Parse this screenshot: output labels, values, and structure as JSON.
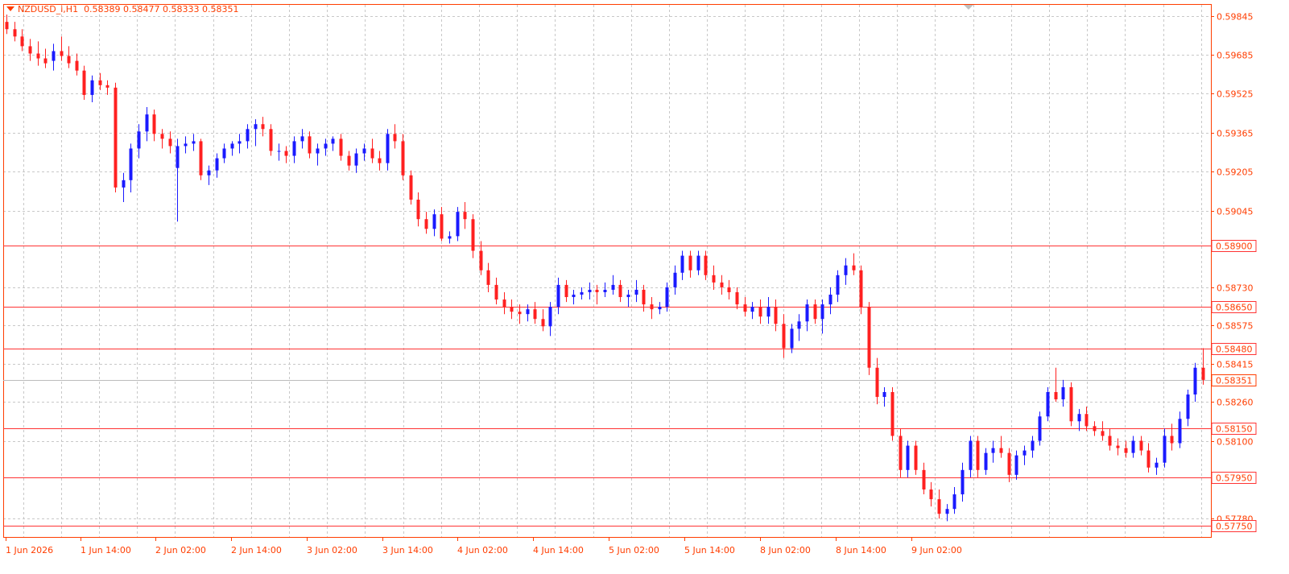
{
  "header": {
    "symbol": "NZDUSD_i,H1",
    "ohlc": "0.58389 0.58477 0.58333 0.58351"
  },
  "colors": {
    "up": "#1a1aff",
    "down": "#ff2020",
    "grid": "#c8c8c8",
    "axis_text": "#ff3d00",
    "hline": "#ff3333",
    "frame": "#ff3d00"
  },
  "chart_data": {
    "type": "candlestick",
    "y_range": [
      0.57705,
      0.5989
    ],
    "y_ticks": [
      "0.59845",
      "0.59685",
      "0.59525",
      "0.59365",
      "0.59205",
      "0.59045",
      "0.58730",
      "0.58575",
      "0.58415",
      "0.58260",
      "0.58100",
      "0.57780"
    ],
    "x_ticks": [
      "1 Jun 2026",
      "1 Jun 14:00",
      "2 Jun 02:00",
      "2 Jun 14:00",
      "3 Jun 02:00",
      "3 Jun 14:00",
      "4 Jun 02:00",
      "4 Jun 14:00",
      "5 Jun 02:00",
      "5 Jun 14:00",
      "8 Jun 02:00",
      "8 Jun 14:00",
      "9 Jun 02:00"
    ],
    "horizontal_levels": [
      "0.58900",
      "0.58650",
      "0.58480",
      "0.58150",
      "0.57950",
      "0.57750"
    ],
    "current_price": "0.58351",
    "candles": [
      [
        0.5982,
        0.5985,
        0.5977,
        0.5979
      ],
      [
        0.5979,
        0.5982,
        0.5974,
        0.5976
      ],
      [
        0.5976,
        0.5979,
        0.597,
        0.5972
      ],
      [
        0.5972,
        0.5975,
        0.5966,
        0.5969
      ],
      [
        0.5969,
        0.5974,
        0.5964,
        0.5967
      ],
      [
        0.5967,
        0.5971,
        0.5963,
        0.5965
      ],
      [
        0.5966,
        0.5973,
        0.5962,
        0.597
      ],
      [
        0.597,
        0.5976,
        0.5966,
        0.5968
      ],
      [
        0.5968,
        0.5972,
        0.5963,
        0.5965
      ],
      [
        0.5966,
        0.5969,
        0.596,
        0.5962
      ],
      [
        0.5962,
        0.5964,
        0.595,
        0.5952
      ],
      [
        0.5952,
        0.596,
        0.5949,
        0.5958
      ],
      [
        0.5958,
        0.5961,
        0.5954,
        0.5956
      ],
      [
        0.5956,
        0.5958,
        0.5952,
        0.5955
      ],
      [
        0.5955,
        0.5957,
        0.5912,
        0.5914
      ],
      [
        0.5914,
        0.592,
        0.5908,
        0.5917
      ],
      [
        0.5917,
        0.5932,
        0.5912,
        0.593
      ],
      [
        0.593,
        0.594,
        0.5926,
        0.5937
      ],
      [
        0.5937,
        0.5947,
        0.5933,
        0.5944
      ],
      [
        0.5944,
        0.5946,
        0.5933,
        0.5936
      ],
      [
        0.5936,
        0.5938,
        0.593,
        0.5934
      ],
      [
        0.5934,
        0.5937,
        0.5928,
        0.5931
      ],
      [
        0.5922,
        0.5934,
        0.59,
        0.5931
      ],
      [
        0.5931,
        0.5935,
        0.5928,
        0.5932
      ],
      [
        0.5932,
        0.5936,
        0.5929,
        0.5933
      ],
      [
        0.5933,
        0.5934,
        0.5917,
        0.5919
      ],
      [
        0.5919,
        0.5923,
        0.5915,
        0.5921
      ],
      [
        0.5921,
        0.5928,
        0.5918,
        0.5926
      ],
      [
        0.5926,
        0.5932,
        0.5924,
        0.593
      ],
      [
        0.593,
        0.5933,
        0.5927,
        0.5932
      ],
      [
        0.5932,
        0.5936,
        0.5928,
        0.5933
      ],
      [
        0.5933,
        0.594,
        0.593,
        0.5938
      ],
      [
        0.5938,
        0.5942,
        0.5931,
        0.594
      ],
      [
        0.594,
        0.5943,
        0.5935,
        0.5938
      ],
      [
        0.5938,
        0.594,
        0.5927,
        0.5929
      ],
      [
        0.5929,
        0.5932,
        0.5925,
        0.5929
      ],
      [
        0.5929,
        0.5931,
        0.5924,
        0.5927
      ],
      [
        0.5927,
        0.5935,
        0.5924,
        0.5933
      ],
      [
        0.5933,
        0.5938,
        0.593,
        0.5935
      ],
      [
        0.5935,
        0.5937,
        0.5926,
        0.5928
      ],
      [
        0.5928,
        0.5932,
        0.5923,
        0.593
      ],
      [
        0.593,
        0.5934,
        0.5927,
        0.5932
      ],
      [
        0.5932,
        0.5935,
        0.5929,
        0.5934
      ],
      [
        0.5934,
        0.5936,
        0.5925,
        0.5927
      ],
      [
        0.5927,
        0.5929,
        0.5921,
        0.5923
      ],
      [
        0.5923,
        0.593,
        0.592,
        0.5928
      ],
      [
        0.5928,
        0.5932,
        0.5925,
        0.593
      ],
      [
        0.593,
        0.5934,
        0.5924,
        0.5926
      ],
      [
        0.5926,
        0.5929,
        0.5921,
        0.5924
      ],
      [
        0.5924,
        0.5938,
        0.5921,
        0.5936
      ],
      [
        0.5936,
        0.594,
        0.593,
        0.5933
      ],
      [
        0.5933,
        0.5936,
        0.5917,
        0.5919
      ],
      [
        0.5919,
        0.5921,
        0.5907,
        0.5909
      ],
      [
        0.5909,
        0.5912,
        0.5898,
        0.5901
      ],
      [
        0.5901,
        0.5904,
        0.5895,
        0.5897
      ],
      [
        0.5897,
        0.5905,
        0.5894,
        0.5903
      ],
      [
        0.5903,
        0.5906,
        0.5892,
        0.5893
      ],
      [
        0.5893,
        0.5896,
        0.5891,
        0.5894
      ],
      [
        0.5894,
        0.5906,
        0.5892,
        0.5904
      ],
      [
        0.5904,
        0.5908,
        0.5897,
        0.5901
      ],
      [
        0.5901,
        0.5903,
        0.5885,
        0.5888
      ],
      [
        0.5888,
        0.5892,
        0.5878,
        0.588
      ],
      [
        0.588,
        0.5883,
        0.5871,
        0.5874
      ],
      [
        0.5874,
        0.5877,
        0.5866,
        0.5868
      ],
      [
        0.5868,
        0.5871,
        0.5862,
        0.5865
      ],
      [
        0.5865,
        0.5868,
        0.586,
        0.5863
      ],
      [
        0.5863,
        0.5866,
        0.5858,
        0.5862
      ],
      [
        0.5862,
        0.5866,
        0.5859,
        0.5864
      ],
      [
        0.5864,
        0.5867,
        0.5858,
        0.586
      ],
      [
        0.586,
        0.5864,
        0.5855,
        0.5857
      ],
      [
        0.5857,
        0.5867,
        0.5853,
        0.5865
      ],
      [
        0.5865,
        0.5877,
        0.5862,
        0.5874
      ],
      [
        0.5874,
        0.5876,
        0.5867,
        0.5869
      ],
      [
        0.5869,
        0.5872,
        0.5866,
        0.587
      ],
      [
        0.587,
        0.5873,
        0.5868,
        0.5871
      ],
      [
        0.5871,
        0.5875,
        0.5868,
        0.5872
      ],
      [
        0.5872,
        0.5874,
        0.5866,
        0.5871
      ],
      [
        0.5871,
        0.5875,
        0.5869,
        0.5872
      ],
      [
        0.5872,
        0.5878,
        0.587,
        0.5874
      ],
      [
        0.5874,
        0.5876,
        0.5867,
        0.5869
      ],
      [
        0.5869,
        0.5872,
        0.5865,
        0.587
      ],
      [
        0.587,
        0.5876,
        0.5867,
        0.5872
      ],
      [
        0.5872,
        0.5874,
        0.5863,
        0.5866
      ],
      [
        0.5866,
        0.5869,
        0.586,
        0.5864
      ],
      [
        0.5864,
        0.5867,
        0.5862,
        0.5865
      ],
      [
        0.5865,
        0.5875,
        0.5863,
        0.5873
      ],
      [
        0.5873,
        0.5882,
        0.587,
        0.5879
      ],
      [
        0.5879,
        0.5888,
        0.5876,
        0.5886
      ],
      [
        0.5886,
        0.5888,
        0.5877,
        0.588
      ],
      [
        0.588,
        0.5888,
        0.5878,
        0.5886
      ],
      [
        0.5886,
        0.5888,
        0.5876,
        0.5878
      ],
      [
        0.5878,
        0.5882,
        0.5872,
        0.5875
      ],
      [
        0.5875,
        0.5878,
        0.587,
        0.5873
      ],
      [
        0.5873,
        0.5876,
        0.5868,
        0.5871
      ],
      [
        0.5871,
        0.5873,
        0.5864,
        0.5866
      ],
      [
        0.5866,
        0.5869,
        0.5861,
        0.5863
      ],
      [
        0.5863,
        0.5867,
        0.586,
        0.5865
      ],
      [
        0.5865,
        0.5868,
        0.5858,
        0.5861
      ],
      [
        0.5861,
        0.5869,
        0.5858,
        0.5865
      ],
      [
        0.5865,
        0.5868,
        0.5855,
        0.5858
      ],
      [
        0.5858,
        0.5862,
        0.5844,
        0.5848
      ],
      [
        0.5848,
        0.5858,
        0.5846,
        0.5856
      ],
      [
        0.5856,
        0.5862,
        0.5851,
        0.5859
      ],
      [
        0.5859,
        0.5868,
        0.5855,
        0.5866
      ],
      [
        0.5866,
        0.5868,
        0.5858,
        0.586
      ],
      [
        0.586,
        0.5868,
        0.5854,
        0.5866
      ],
      [
        0.5866,
        0.5873,
        0.5862,
        0.587
      ],
      [
        0.587,
        0.588,
        0.5867,
        0.5878
      ],
      [
        0.5878,
        0.5885,
        0.5874,
        0.5882
      ],
      [
        0.5882,
        0.5887,
        0.5878,
        0.588
      ],
      [
        0.588,
        0.5882,
        0.5862,
        0.5865
      ],
      [
        0.5865,
        0.5867,
        0.5837,
        0.584
      ],
      [
        0.584,
        0.5844,
        0.5825,
        0.5828
      ],
      [
        0.5828,
        0.5832,
        0.5824,
        0.583
      ],
      [
        0.583,
        0.5832,
        0.581,
        0.5812
      ],
      [
        0.5812,
        0.5815,
        0.5795,
        0.5798
      ],
      [
        0.5798,
        0.581,
        0.5795,
        0.5808
      ],
      [
        0.5808,
        0.581,
        0.5796,
        0.5798
      ],
      [
        0.5798,
        0.5801,
        0.5788,
        0.579
      ],
      [
        0.579,
        0.5793,
        0.5783,
        0.5786
      ],
      [
        0.5786,
        0.579,
        0.5778,
        0.578
      ],
      [
        0.578,
        0.5784,
        0.5777,
        0.5782
      ],
      [
        0.5782,
        0.5791,
        0.578,
        0.5788
      ],
      [
        0.5788,
        0.5801,
        0.5785,
        0.5798
      ],
      [
        0.5798,
        0.5812,
        0.5795,
        0.581
      ],
      [
        0.581,
        0.5812,
        0.5795,
        0.5798
      ],
      [
        0.5798,
        0.5807,
        0.5796,
        0.5805
      ],
      [
        0.5805,
        0.581,
        0.5801,
        0.5807
      ],
      [
        0.5807,
        0.5812,
        0.5803,
        0.5805
      ],
      [
        0.5805,
        0.5807,
        0.5793,
        0.5796
      ],
      [
        0.5796,
        0.5806,
        0.5794,
        0.5804
      ],
      [
        0.5804,
        0.5808,
        0.58,
        0.5806
      ],
      [
        0.5806,
        0.5812,
        0.5803,
        0.581
      ],
      [
        0.581,
        0.5822,
        0.5808,
        0.582
      ],
      [
        0.582,
        0.5832,
        0.5818,
        0.583
      ],
      [
        0.583,
        0.584,
        0.5826,
        0.5827
      ],
      [
        0.5827,
        0.5835,
        0.5824,
        0.5832
      ],
      [
        0.5832,
        0.5834,
        0.5816,
        0.5818
      ],
      [
        0.5818,
        0.5823,
        0.5814,
        0.5821
      ],
      [
        0.5821,
        0.5824,
        0.5814,
        0.5816
      ],
      [
        0.5816,
        0.5818,
        0.5812,
        0.5814
      ],
      [
        0.5814,
        0.5818,
        0.581,
        0.5812
      ],
      [
        0.5812,
        0.5815,
        0.5806,
        0.5808
      ],
      [
        0.5808,
        0.5811,
        0.5804,
        0.5807
      ],
      [
        0.5807,
        0.581,
        0.5803,
        0.5805
      ],
      [
        0.5805,
        0.5812,
        0.5803,
        0.581
      ],
      [
        0.581,
        0.5812,
        0.5804,
        0.5806
      ],
      [
        0.5806,
        0.5809,
        0.5797,
        0.5799
      ],
      [
        0.5799,
        0.5803,
        0.5796,
        0.5801
      ],
      [
        0.5801,
        0.5815,
        0.5799,
        0.5812
      ],
      [
        0.5812,
        0.5817,
        0.5806,
        0.5809
      ],
      [
        0.5809,
        0.5822,
        0.5807,
        0.5819
      ],
      [
        0.5819,
        0.5831,
        0.5816,
        0.5829
      ],
      [
        0.5829,
        0.5842,
        0.5826,
        0.584
      ],
      [
        0.584,
        0.5848,
        0.5833,
        0.5835
      ]
    ]
  }
}
